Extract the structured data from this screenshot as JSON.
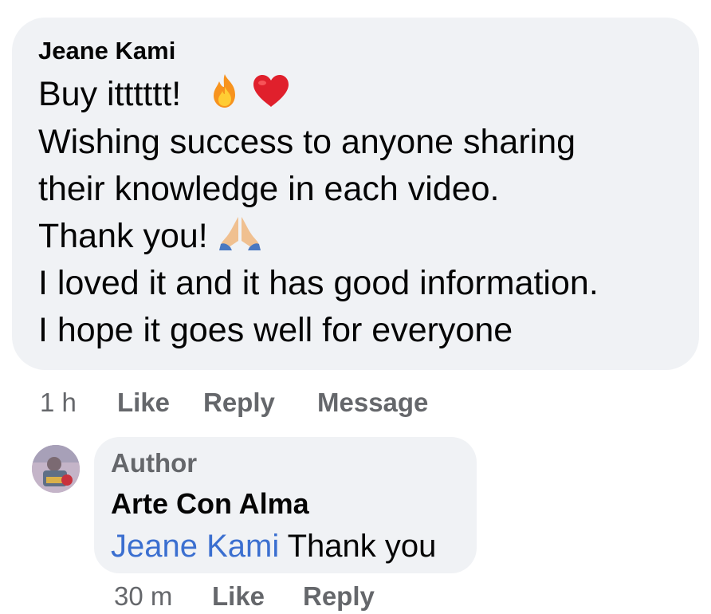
{
  "comment": {
    "author": "Jeane Kami",
    "lines": [
      "Buy itttttt!",
      "Wishing success to anyone sharing",
      "their knowledge in each video.",
      "Thank you!",
      "I loved it and it has good information.",
      "I hope it goes well for everyone"
    ],
    "emojis": [
      "fire-icon",
      "heart-icon",
      "praying-hands-icon"
    ],
    "time": "1 h",
    "actions": {
      "like": "Like",
      "reply": "Reply",
      "message": "Message"
    }
  },
  "reply": {
    "badge": "Author",
    "author": "Arte Con Alma",
    "mention": "Jeane Kami",
    "text": " Thank you",
    "time": "30 m",
    "actions": {
      "like": "Like",
      "reply": "Reply"
    }
  },
  "colors": {
    "bubble": "#f0f2f5",
    "secondary_text": "#65676b",
    "mention": "#3b6fd0",
    "heart": "#e0202c",
    "fire": "#f5a623"
  }
}
